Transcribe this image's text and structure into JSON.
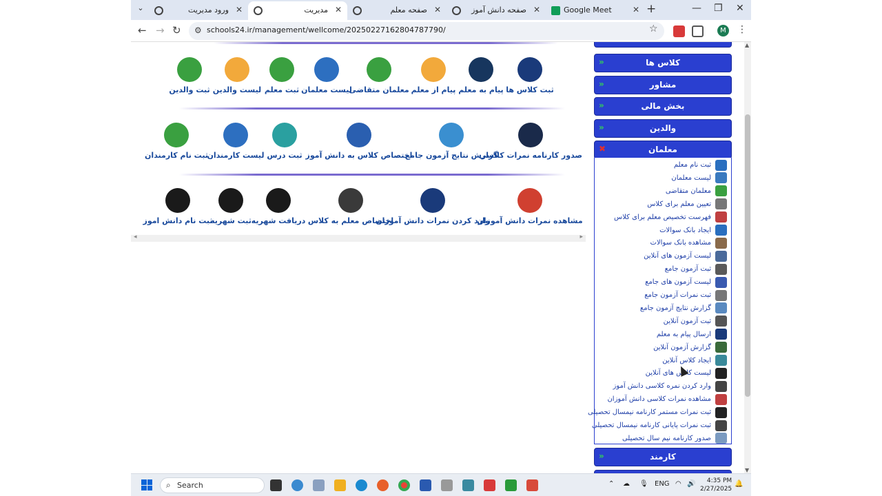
{
  "browser": {
    "tabs": [
      {
        "title": "ورود مدیریت",
        "active": false
      },
      {
        "title": "مدیریت",
        "active": true
      },
      {
        "title": "صفحه معلم",
        "active": false
      },
      {
        "title": "صفحه دانش آموز",
        "active": false
      },
      {
        "title": "Google Meet",
        "active": false
      }
    ],
    "url": "schools24.ir/management/wellcome/20250227162804787790/"
  },
  "main": {
    "row1": [
      {
        "label": "ثبت کلاس ها",
        "icon": "presentation-board-icon",
        "color": "#1a3a7a"
      },
      {
        "label": "پیام به معلم",
        "icon": "forward-message-icon",
        "color": "#17365e"
      },
      {
        "label": "پیام از معلم",
        "icon": "envelope-icon",
        "color": "#f2a93b"
      },
      {
        "label": "معلمان متقاضی",
        "icon": "clipboard-icon",
        "color": "#3aa040"
      },
      {
        "label": "لیست معلمان",
        "icon": "teachers-group-icon",
        "color": "#2d6fc0"
      },
      {
        "label": "ثبت معلم",
        "icon": "teacher-add-icon",
        "color": "#3aa040"
      },
      {
        "label": "لیست والدین",
        "icon": "parents-list-icon",
        "color": "#f2a93b"
      },
      {
        "label": "ثبت والدین",
        "icon": "parents-add-icon",
        "color": "#3aa040"
      }
    ],
    "row2": [
      {
        "label": "صدور کارنامه نمرات کلاسی",
        "icon": "graduation-books-icon",
        "color": "#1a2a4a"
      },
      {
        "label": "گزارش نتایج آزمون جامع",
        "icon": "grade-certificate-icon",
        "color": "#3a8fd0"
      },
      {
        "label": "اختصاص کلاس به دانش آموز",
        "icon": "class-students-icon",
        "color": "#2a5fb0"
      },
      {
        "label": "ثبت درس",
        "icon": "notebook-icon",
        "color": "#2aa0a0"
      },
      {
        "label": "لیست کارمندان",
        "icon": "staff-list-icon",
        "color": "#2d6fc0"
      },
      {
        "label": "ثبت نام کارمندان",
        "icon": "staff-add-icon",
        "color": "#3aa040"
      }
    ],
    "row3": [
      {
        "label": "مشاهده نمرات دانش آموزان",
        "icon": "bar-chart-icon",
        "color": "#d04030"
      },
      {
        "label": "وارد کردن نمرات دانش آموزان",
        "icon": "checklist-icon",
        "color": "#1a3a7a"
      },
      {
        "label": "اختصاص معلم به کلاس",
        "icon": "teacher-board-icon",
        "color": "#3a3a3a"
      },
      {
        "label": "دریافت شهریه",
        "icon": "graduate-coin-icon",
        "color": "#1a1a1a"
      },
      {
        "label": "ثبت شهریه",
        "icon": "coin-icon",
        "color": "#1a1a1a"
      },
      {
        "label": "ثبت نام دانش اموز",
        "icon": "student-add-icon",
        "color": "#1a1a1a"
      }
    ]
  },
  "sidebar": {
    "menus_top": [
      {
        "label": "کلاس ها"
      },
      {
        "label": "مشاور"
      },
      {
        "label": "بخش مالی"
      },
      {
        "label": "والدین"
      },
      {
        "label": "معلمان"
      }
    ],
    "submenu": [
      "ثبت نام معلم",
      "لیست معلمان",
      "معلمان متقاضی",
      "تعیین معلم برای کلاس",
      "فهرست تخصیص معلم برای کلاس",
      "ایجاد بانک سوالات",
      "مشاهده بانک سوالات",
      "لیست آزمون های آنلاین",
      "ثبت آزمون جامع",
      "لیست آزمون های جامع",
      "ثبت نمرات آزمون جامع",
      "گزارش نتایج آزمون جامع",
      "ثبت آزمون آنلاین",
      "ارسال پیام به معلم",
      "گزارش آزمون آنلاین",
      "ایجاد کلاس آنلاین",
      "لیست کلاس های آنلاین",
      "وارد کردن نمره کلاسی دانش آموز",
      "مشاهده نمرات کلاسی دانش آموزان",
      "ثبت نمرات مستمر کارنامه نیمسال تحصیلی",
      "ثبت نمرات پایانی کارنامه نیمسال تحصیلی",
      "صدور کارنامه نیم سال تحصیلی"
    ],
    "submenu_colors": [
      "#2a6fbf",
      "#3a7abf",
      "#3aa040",
      "#777777",
      "#c04040",
      "#2a6fbf",
      "#8a6a4a",
      "#4a6a9a",
      "#5a5a5a",
      "#3a5ab0",
      "#777777",
      "#5a8ac0",
      "#555555",
      "#1a3a7a",
      "#3a6a3a",
      "#3a8a9a",
      "#222222",
      "#444444",
      "#c04040",
      "#222222",
      "#444444",
      "#7a9ac0"
    ],
    "menu_bottom": {
      "label": "کارمند"
    }
  },
  "taskbar": {
    "search_placeholder": "Search",
    "lang": "ENG",
    "time": "4:35 PM",
    "date": "2/27/2025"
  }
}
